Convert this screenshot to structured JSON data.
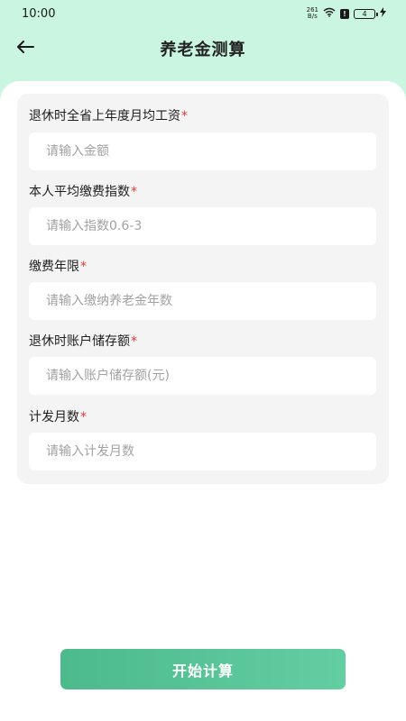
{
  "status_bar": {
    "time": "10:00",
    "net_speed_value": "261",
    "net_speed_unit": "B/s",
    "battery_level": "4"
  },
  "nav": {
    "title": "养老金测算"
  },
  "form": {
    "fields": [
      {
        "label": "退休时全省上年度月均工资",
        "required_mark": "*",
        "placeholder": "请输入金额"
      },
      {
        "label": "本人平均缴费指数",
        "required_mark": "*",
        "placeholder": "请输入指数0.6-3"
      },
      {
        "label": "缴费年限",
        "required_mark": "*",
        "placeholder": "请输入缴纳养老金年数"
      },
      {
        "label": "退休时账户储存额",
        "required_mark": "*",
        "placeholder": "请输入账户储存额(元)"
      },
      {
        "label": "计发月数",
        "required_mark": "*",
        "placeholder": "请输入计发月数"
      }
    ]
  },
  "actions": {
    "submit_label": "开始计算"
  },
  "colors": {
    "header_bg": "#c9f5e1",
    "card_bg": "#f3f4f3",
    "accent_start": "#4dba8b",
    "accent_end": "#62cea2",
    "required": "#e53935"
  }
}
